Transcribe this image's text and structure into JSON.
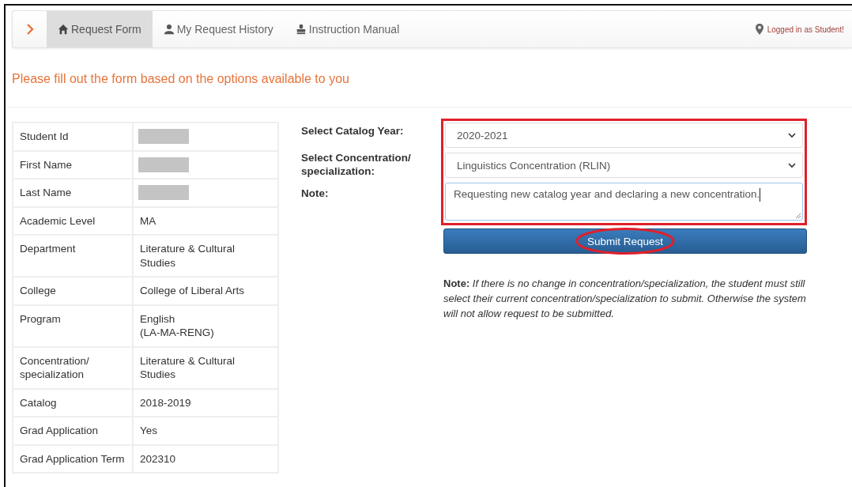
{
  "navbar": {
    "items": [
      {
        "label": "Request Form",
        "selected": true
      },
      {
        "label": "My Request History",
        "selected": false
      },
      {
        "label": "Instruction Manual",
        "selected": false
      }
    ],
    "status": "Logged in as Student!"
  },
  "heading": "Please fill out the form based on the options available to you",
  "student_info": [
    {
      "label": "Student Id",
      "kind": "redacted"
    },
    {
      "label": "First Name",
      "kind": "redacted"
    },
    {
      "label": "Last Name",
      "kind": "redacted"
    },
    {
      "label": "Academic Level",
      "kind": "text",
      "value": "MA"
    },
    {
      "label": "Department",
      "kind": "text",
      "value": "Literature & Cultural Studies"
    },
    {
      "label": "College",
      "kind": "text",
      "value": "College of Liberal Arts"
    },
    {
      "label": "Program",
      "kind": "text",
      "value": "English\n(LA-MA-RENG)"
    },
    {
      "label": "Concentration/ specialization",
      "kind": "text",
      "value": "Literature & Cultural Studies"
    },
    {
      "label": "Catalog",
      "kind": "text",
      "value": "2018-2019"
    },
    {
      "label": "Grad Application",
      "kind": "text",
      "value": "Yes"
    },
    {
      "label": "Grad Application Term",
      "kind": "text",
      "value": "202310"
    }
  ],
  "form": {
    "fields": [
      {
        "label": "Select Catalog Year:",
        "kind": "select",
        "value": "2020-2021"
      },
      {
        "label": "Select Concentration/ specialization:",
        "kind": "select",
        "value": "Linguistics Concentration (RLIN)"
      },
      {
        "label": "Note:",
        "kind": "textarea",
        "value": "Requesting new catalog year and declaring a new concentration."
      }
    ],
    "submit": "Submit Request",
    "note_label": "Note:",
    "note_text": "If there is no change in concentration/specialization, the student must still select their current concentration/specialization to submit. Otherwise the system will not allow request to be submitted.",
    "fields_highlighted": true,
    "submit_circled": true
  }
}
